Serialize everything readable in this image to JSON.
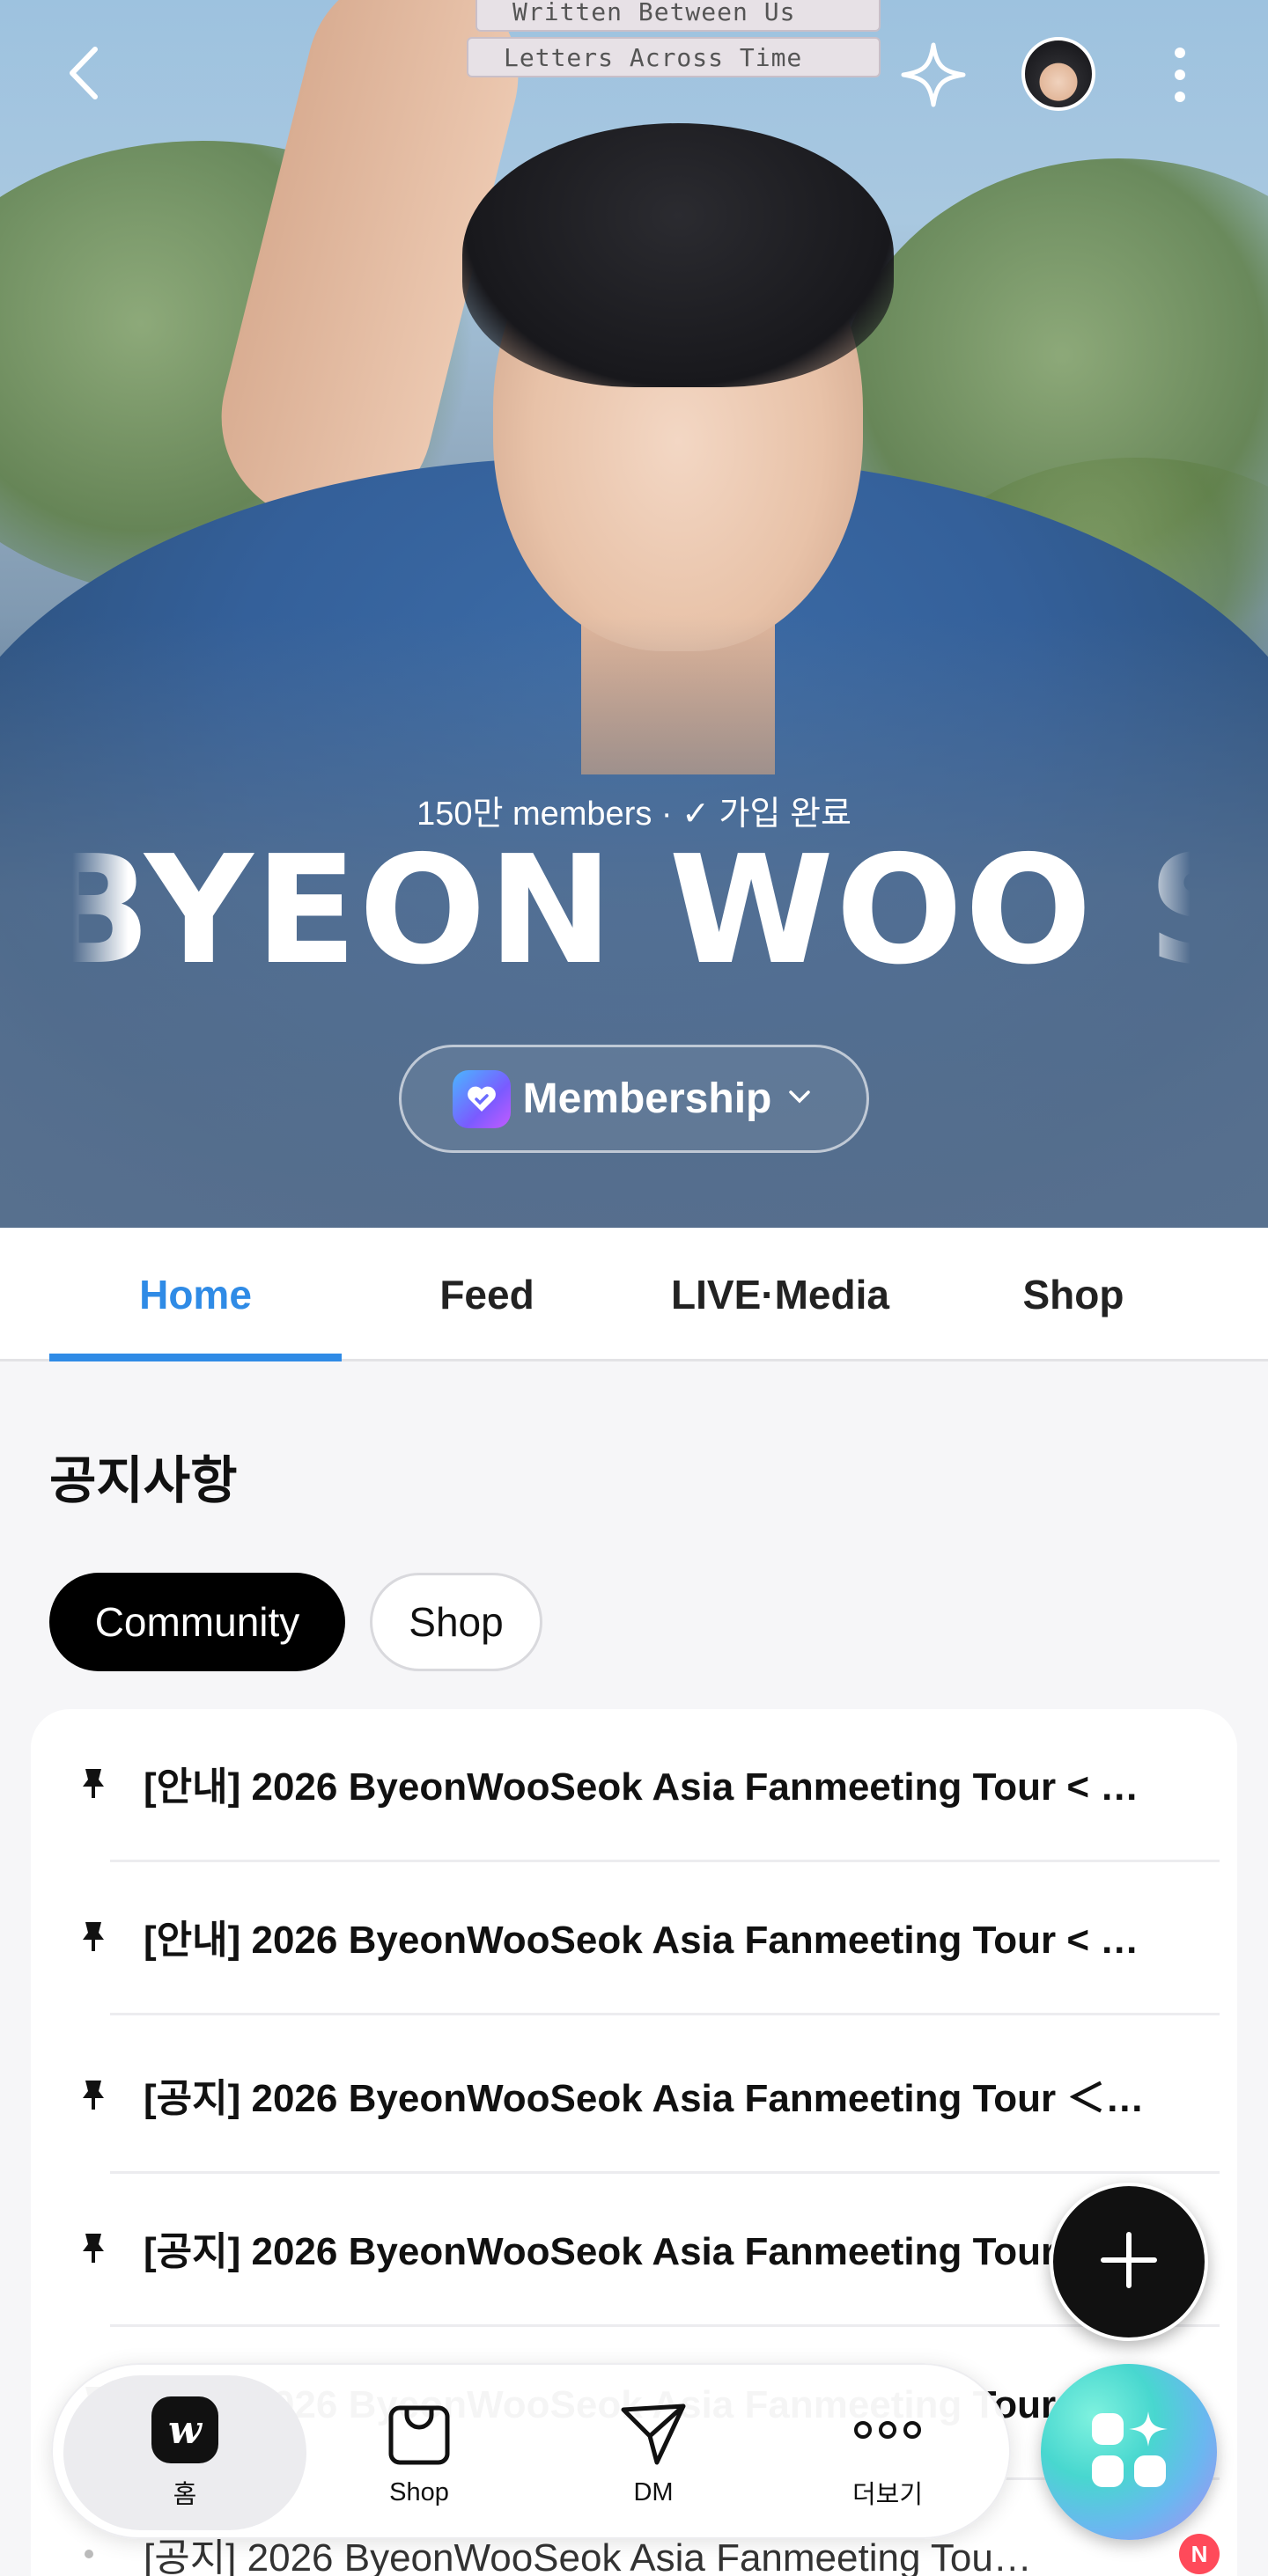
{
  "hero": {
    "books": [
      "Written Between Us",
      "Letters Across Time"
    ],
    "members_text": "150만 members · ✓ 가입 완료",
    "artist_name": "BYEON WOO SEOK",
    "membership_label": "Membership"
  },
  "tabs": [
    {
      "label": "Home",
      "active": true
    },
    {
      "label": "Feed",
      "active": false
    },
    {
      "label": "LIVE·Media",
      "active": false
    },
    {
      "label": "Shop",
      "active": false
    }
  ],
  "notices": {
    "title": "공지사항",
    "chips": [
      {
        "label": "Community",
        "selected": true
      },
      {
        "label": "Shop",
        "selected": false
      }
    ],
    "items": [
      {
        "text": "[안내] 2026 ByeonWooSeok Asia Fanmeeting Tour < …",
        "pinned": true
      },
      {
        "text": "[안내] 2026 ByeonWooSeok Asia Fanmeeting Tour < …",
        "pinned": true
      },
      {
        "text": "[공지] 2026 ByeonWooSeok Asia Fanmeeting Tour ＜…",
        "pinned": true
      },
      {
        "text": "[공지] 2026 ByeonWooSeok Asia Fanmeeting Tour ＜ LET…",
        "pinned": true
      },
      {
        "text": "[공지] 2026 ByeonWooSeok Asia Fanmeeting Tour ＜ LET…",
        "pinned": true
      },
      {
        "text": "[공지] 2026 ByeonWooSeok Asia Fanmeeting Tou…",
        "pinned": false,
        "new_badge": "N"
      }
    ]
  },
  "bottom_nav": [
    {
      "label": "홈",
      "icon": "weverse-home-icon",
      "active": true
    },
    {
      "label": "Shop",
      "icon": "shopping-bag-icon",
      "active": false
    },
    {
      "label": "DM",
      "icon": "paper-plane-icon",
      "active": false
    },
    {
      "label": "더보기",
      "icon": "more-dots-icon",
      "active": false
    }
  ],
  "colors": {
    "accent": "#2f8be6",
    "chip_selected_bg": "#000000",
    "new_badge": "#ff4a5a"
  }
}
